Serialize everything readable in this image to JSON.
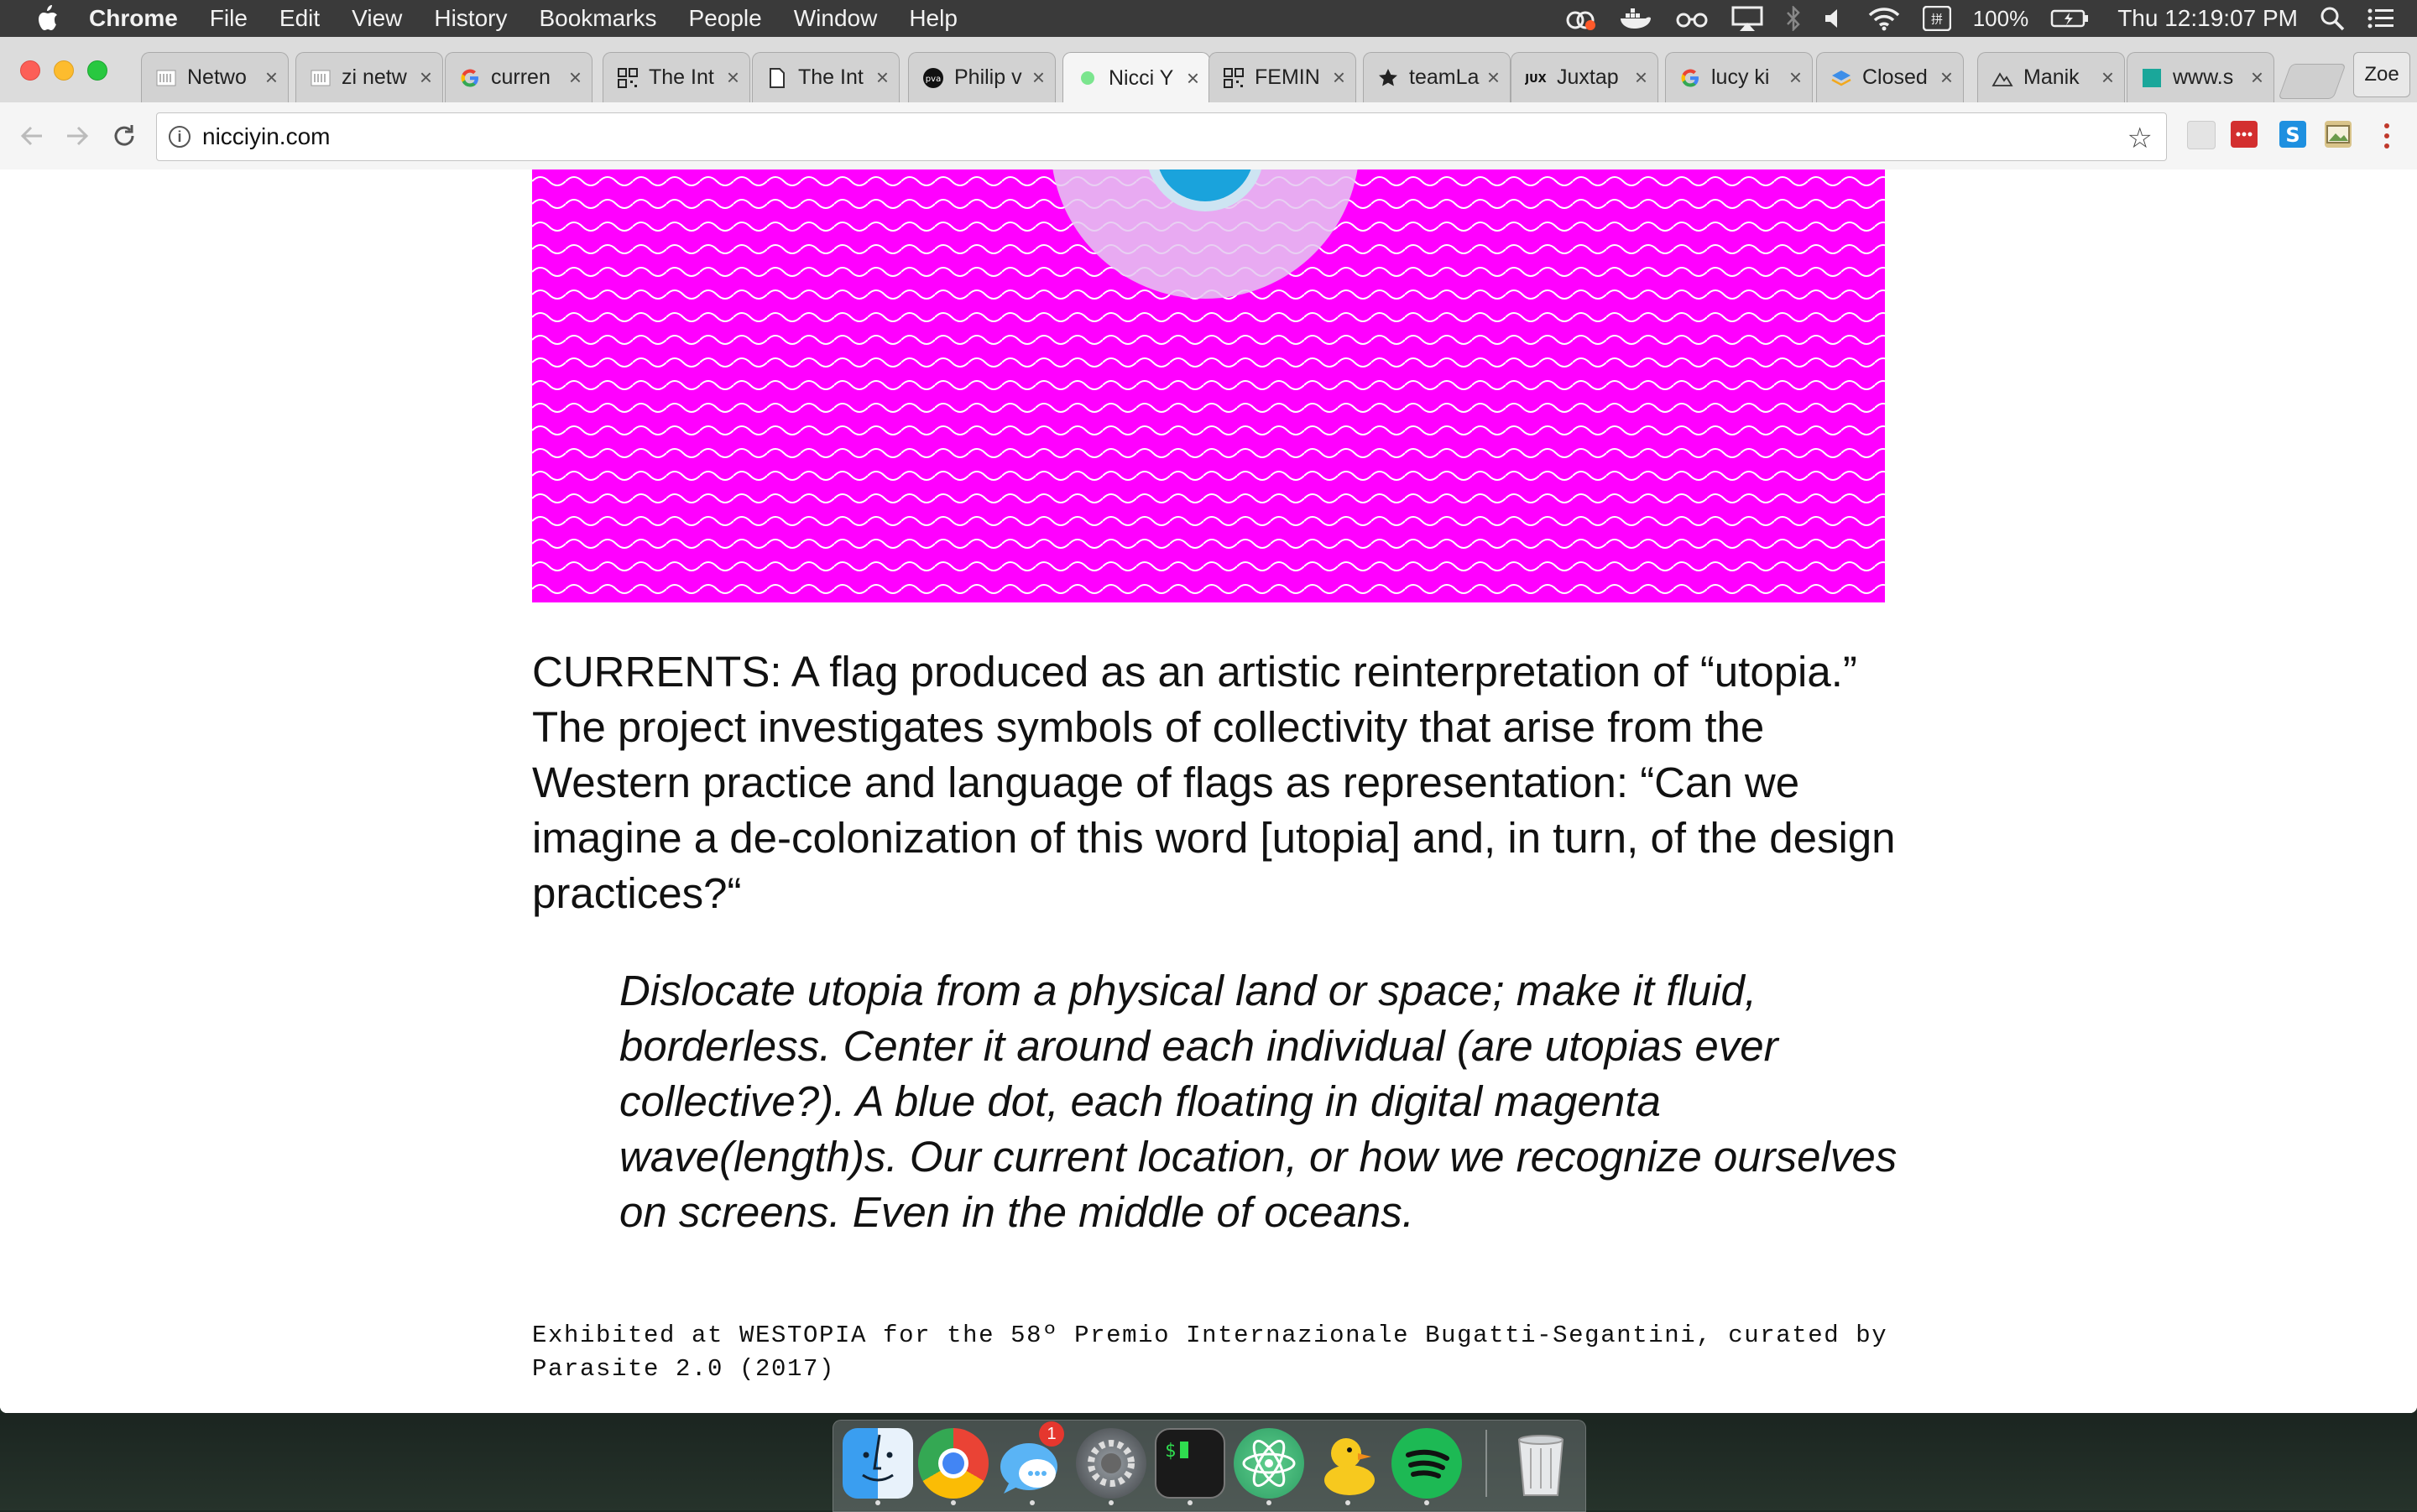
{
  "menubar": {
    "app": "Chrome",
    "items": [
      "File",
      "Edit",
      "View",
      "History",
      "Bookmarks",
      "People",
      "Window",
      "Help"
    ],
    "battery": "100%",
    "clock": "Thu 12:19:07 PM"
  },
  "tabs": [
    {
      "title": "Netwo",
      "favicon": "page-grid-icon"
    },
    {
      "title": "zi netw",
      "favicon": "page-grid-icon"
    },
    {
      "title": "curren",
      "favicon": "google-icon"
    },
    {
      "title": "The Int",
      "favicon": "qr-icon"
    },
    {
      "title": "The Int",
      "favicon": "document-icon"
    },
    {
      "title": "Philip v",
      "favicon": "pva-icon"
    },
    {
      "title": "Nicci Y",
      "favicon": "green-dot-icon",
      "active": true
    },
    {
      "title": "FEMIN",
      "favicon": "qr-icon"
    },
    {
      "title": "teamLa",
      "favicon": "star-icon"
    },
    {
      "title": "Juxtap",
      "favicon": "jux-icon"
    },
    {
      "title": "lucy ki",
      "favicon": "google-icon"
    },
    {
      "title": "Closed",
      "favicon": "layers-icon"
    },
    {
      "title": "Manik",
      "favicon": "mountain-icon"
    },
    {
      "title": "www.s",
      "favicon": "teal-square-icon"
    }
  ],
  "profile": "Zoe",
  "address": "nicciyin.com",
  "article": {
    "paragraph": "CURRENTS: A flag produced as an artistic reinterpretation of “utopia.” The project investigates symbols of collectivity that arise from the Western practice and language of flags as representation: “Can we imagine a de-colonization of this word [utopia] and, in turn, of the design practices?“",
    "quote": "Dislocate utopia from a physical land or space; make it fluid, borderless. Center it around each individual (are utopias ever collective?). A blue dot, each floating in digital magenta wave(length)s. Our current location, or how we recognize ourselves on screens. Even in the middle of oceans.",
    "credit": "Exhibited at WESTOPIA for the 58º Premio Internazionale Bugatti-Segantini, curated by Parasite 2.0 (2017)"
  },
  "dock": {
    "apps": [
      "finder-icon",
      "chrome-icon",
      "messages-icon",
      "system-preferences-icon",
      "terminal-icon",
      "atom-icon",
      "cyberduck-icon",
      "spotify-icon",
      "trash-icon"
    ],
    "messages_badge": "1"
  },
  "colors": {
    "flag_magenta": "#ff00ff",
    "flag_dot": "#1aa3dc",
    "menubar": "#3a3a3a"
  }
}
